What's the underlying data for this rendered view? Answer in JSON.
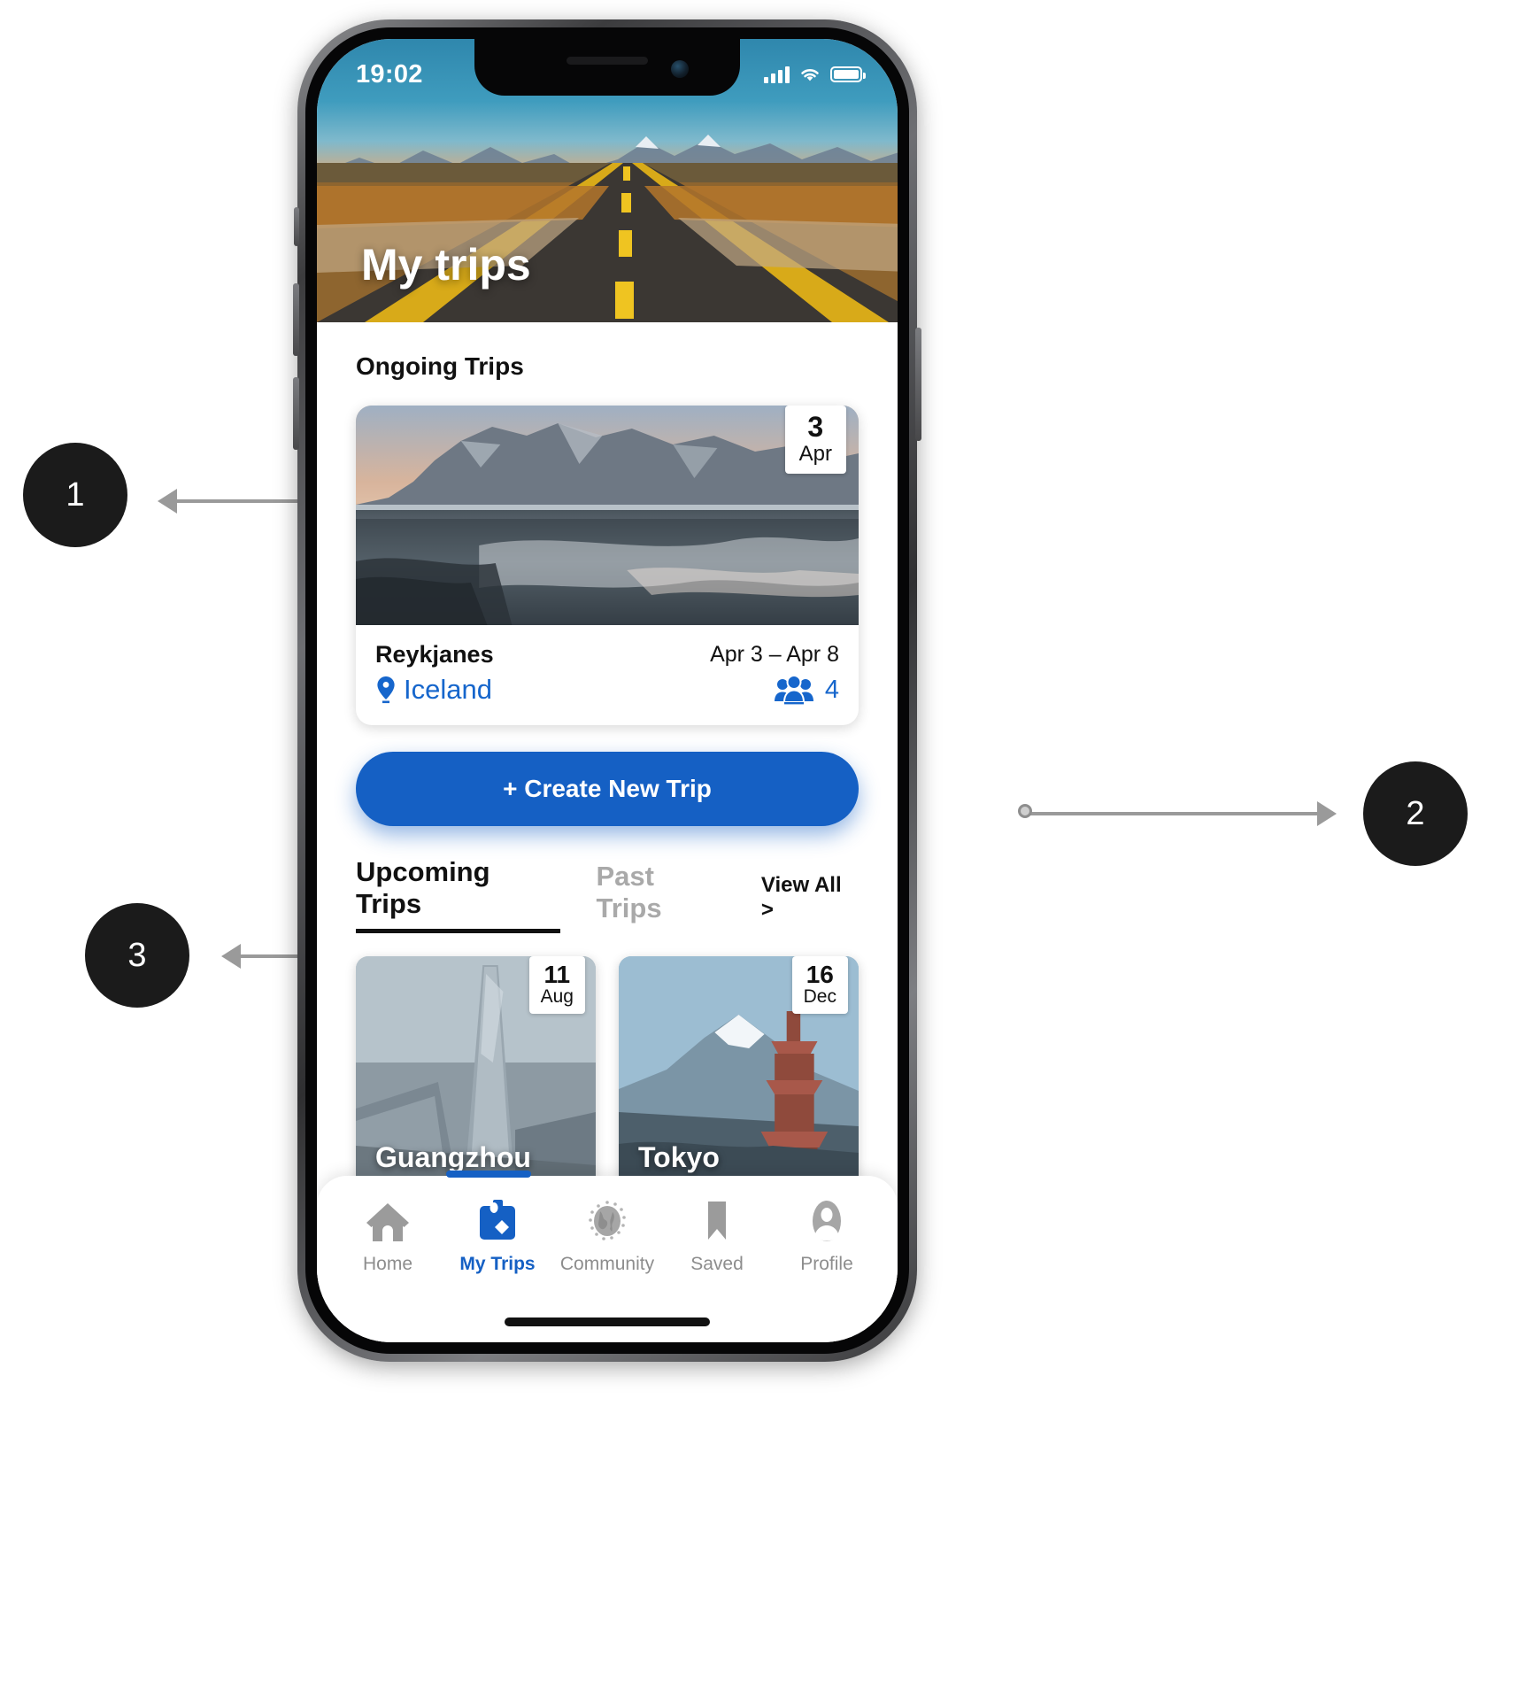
{
  "annotations": [
    {
      "number": "1",
      "target": "ongoing-trip-card"
    },
    {
      "number": "2",
      "target": "create-new-trip-button"
    },
    {
      "number": "3",
      "target": "upcoming-trips-tabs"
    }
  ],
  "status_bar": {
    "time": "19:02",
    "signal_icon": "cellular-signal-icon",
    "wifi_icon": "wifi-icon",
    "battery_icon": "battery-icon"
  },
  "hero": {
    "title": "My trips",
    "image_alt": "desert-highway-photo"
  },
  "main": {
    "ongoing_section_title": "Ongoing Trips",
    "ongoing_trip": {
      "badge_day": "3",
      "badge_month": "Apr",
      "name": "Reykjanes",
      "country": "Iceland",
      "location_icon": "map-pin-icon",
      "dates": "Apr 3 – Apr 8",
      "people_icon": "group-people-icon",
      "people_count": "4",
      "image_alt": "iceland-stokksnes-beach-photo"
    },
    "create_trip_label": "+ Create New Trip",
    "tabs": [
      {
        "label": "Upcoming Trips",
        "active": true
      },
      {
        "label": "Past Trips",
        "active": false
      }
    ],
    "view_all_label": "View All >",
    "upcoming_trips": [
      {
        "name": "Guangzhou",
        "badge_day": "11",
        "badge_month": "Aug",
        "image_alt": "guangzhou-canton-tower-photo"
      },
      {
        "name": "Tokyo",
        "badge_day": "16",
        "badge_month": "Dec",
        "image_alt": "mount-fuji-pagoda-photo"
      }
    ]
  },
  "bottom_nav": [
    {
      "label": "Home",
      "icon": "home-icon",
      "active": false
    },
    {
      "label": "My Trips",
      "icon": "suitcase-icon",
      "active": true
    },
    {
      "label": "Community",
      "icon": "globe-icon",
      "active": false
    },
    {
      "label": "Saved",
      "icon": "bookmark-icon",
      "active": false
    },
    {
      "label": "Profile",
      "icon": "person-avatar-icon",
      "active": false
    }
  ],
  "colors": {
    "accent_blue": "#1560c4",
    "link_blue": "#1666cc",
    "inactive_gray": "#a9a9a9",
    "nav_gray": "#8d8d8d"
  }
}
